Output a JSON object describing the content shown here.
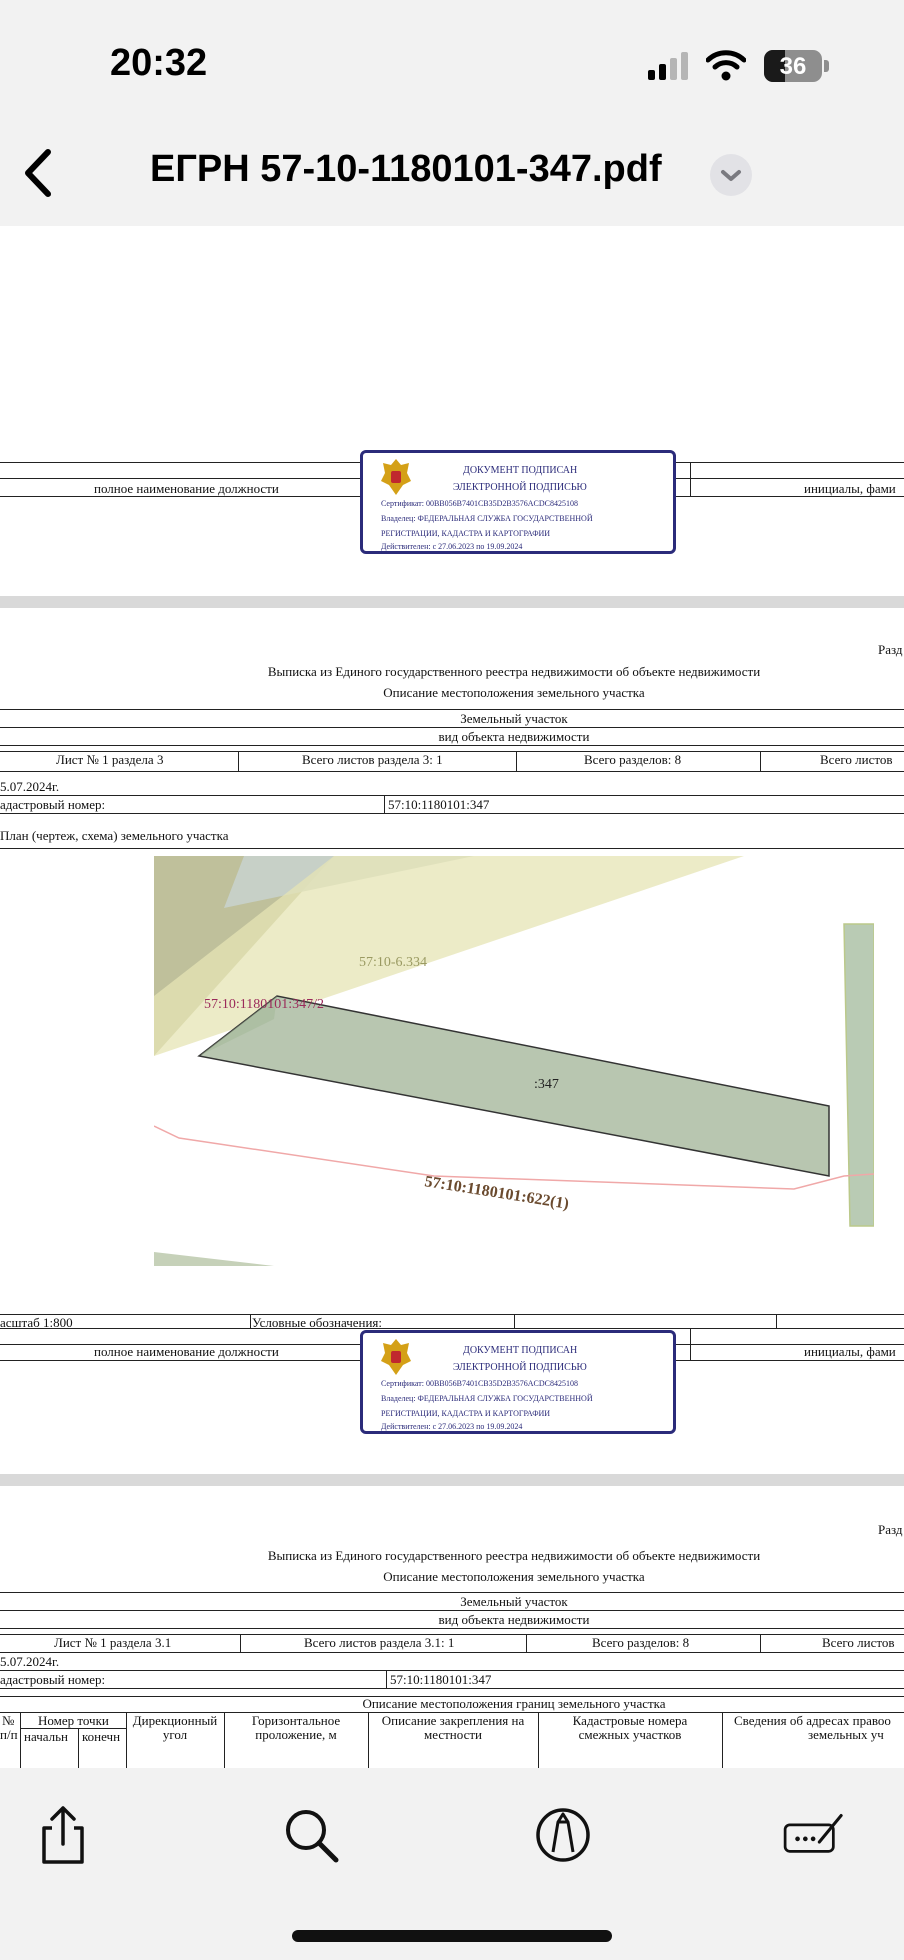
{
  "status": {
    "time": "20:32",
    "battery": "36"
  },
  "nav": {
    "title": "ЕГРН 57-10-1180101-347.pdf"
  },
  "stamp": {
    "line1": "ДОКУМЕНТ ПОДПИСАН",
    "line2": "ЭЛЕКТРОННОЙ ПОДПИСЬЮ",
    "cert": "Сертификат: 00BB056B7401CB35D2B3576ACDC8425108",
    "owner1": "Владелец: ФЕДЕРАЛЬНАЯ СЛУЖБА ГОСУДАРСТВЕННОЙ",
    "owner2": "РЕГИСТРАЦИИ, КАДАСТРА И КАРТОГРАФИИ",
    "valid": "Действителен: с 27.06.2023 по 19.09.2024"
  },
  "signature": {
    "position": "полное наименование должности",
    "initials": "инициалы, фами"
  },
  "page2": {
    "section": "Разд",
    "title": "Выписка из Единого государственного реестра недвижимости об объекте недвижимости",
    "subtitle": "Описание местоположения земельного участка",
    "object": "Земельный участок",
    "object_kind": "вид объекта недвижимости",
    "sheet": "Лист № 1 раздела 3",
    "sheets_total": "Всего листов раздела 3: 1",
    "sections_total": "Всего разделов: 8",
    "all_sheets": "Всего листов",
    "date": "5.07.2024г.",
    "cad_label": "адастровый номер:",
    "cad_value": "57:10:1180101:347",
    "plan_label": "План (чертеж, схема) земельного участка",
    "scale": "асштаб 1:800",
    "legend": "Условные обозначения:"
  },
  "map": {
    "label_neighbor": "57:10-6.334",
    "label_part": "57:10:1180101:347/2",
    "label_main": ":347",
    "label_road": "57:10:1180101:622(1)"
  },
  "page3": {
    "section": "Разд",
    "title": "Выписка из Единого государственного реестра недвижимости об объекте недвижимости",
    "subtitle": "Описание местоположения земельного участка",
    "object": "Земельный участок",
    "object_kind": "вид объекта недвижимости",
    "sheet": "Лист № 1 раздела 3.1",
    "sheets_total": "Всего листов раздела 3.1: 1",
    "sections_total": "Всего разделов: 8",
    "all_sheets": "Всего листов",
    "date": "5.07.2024г.",
    "cad_label": "адастровый номер:",
    "cad_value": "57:10:1180101:347",
    "table_title": "Описание местоположения границ земельного участка",
    "columns": {
      "num": "№",
      "num2": "п/п",
      "point": "Номер точки",
      "point_start": "начальн",
      "point_end": "конечн",
      "angle1": "Дирекционный",
      "angle2": "угол",
      "horiz1": "Горизонтальное",
      "horiz2": "проложение, м",
      "desc1": "Описание закрепления на",
      "desc2": "местности",
      "cad1": "Кадастровые номера",
      "cad2": "смежных участков",
      "addr1": "Сведения об адресах правоо",
      "addr2": "земельных уч"
    }
  }
}
